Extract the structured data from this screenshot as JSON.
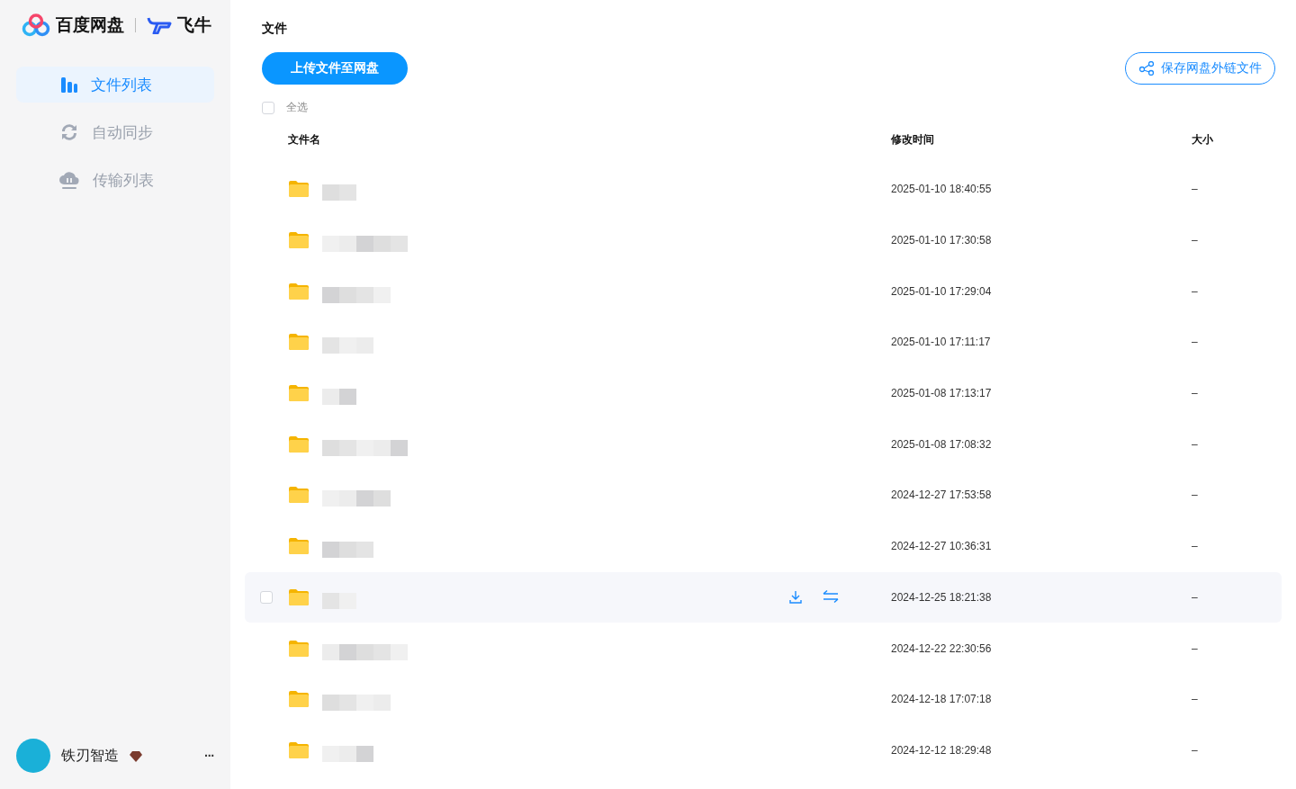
{
  "sidebar": {
    "brand": {
      "name": "百度网盘",
      "partner": "飞牛"
    },
    "items": [
      {
        "label": "文件列表",
        "selected": true
      },
      {
        "label": "自动同步",
        "selected": false
      },
      {
        "label": "传输列表",
        "selected": false
      }
    ],
    "user": {
      "name": "铁刃智造",
      "menu": "···"
    }
  },
  "main": {
    "title": "文件",
    "upload_button": "上传文件至网盘",
    "save_link_button": "保存网盘外链文件",
    "select_all": {
      "label": "全选",
      "checked": false
    },
    "table": {
      "columns": [
        "文件名",
        "修改时间",
        "大小"
      ],
      "rows": [
        {
          "modified": "2025-01-10 18:40:55",
          "size": "–",
          "hovered": false
        },
        {
          "modified": "2025-01-10 17:30:58",
          "size": "–",
          "hovered": false
        },
        {
          "modified": "2025-01-10 17:29:04",
          "size": "–",
          "hovered": false
        },
        {
          "modified": "2025-01-10 17:11:17",
          "size": "–",
          "hovered": false
        },
        {
          "modified": "2025-01-08 17:13:17",
          "size": "–",
          "hovered": false
        },
        {
          "modified": "2025-01-08 17:08:32",
          "size": "–",
          "hovered": false
        },
        {
          "modified": "2024-12-27 17:53:58",
          "size": "–",
          "hovered": false
        },
        {
          "modified": "2024-12-27 10:36:31",
          "size": "–",
          "hovered": false
        },
        {
          "modified": "2024-12-25 18:21:38",
          "size": "–",
          "hovered": true
        },
        {
          "modified": "2024-12-22 22:30:56",
          "size": "–",
          "hovered": false
        },
        {
          "modified": "2024-12-18 17:07:18",
          "size": "–",
          "hovered": false
        },
        {
          "modified": "2024-12-12 18:29:48",
          "size": "–",
          "hovered": false
        }
      ]
    }
  }
}
